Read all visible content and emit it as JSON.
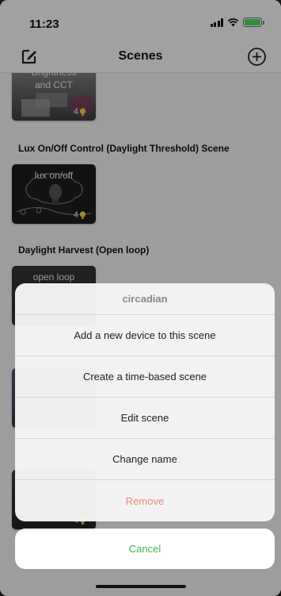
{
  "status_bar": {
    "time": "11:23"
  },
  "nav": {
    "title": "Scenes"
  },
  "scenes": [
    {
      "title": "",
      "card_label": "Brightness and CCT",
      "device_count": "4"
    },
    {
      "title": "Lux On/Off Control (Daylight Threshold) Scene",
      "card_label": "lux on/off",
      "device_count": "4"
    },
    {
      "title": "Daylight Harvest (Open loop)",
      "card_label": "open loop",
      "device_count": ""
    },
    {
      "title": "",
      "card_label": "",
      "device_count": "4"
    }
  ],
  "action_sheet": {
    "header": "circadian",
    "options": [
      {
        "label": "Add a new device to this scene"
      },
      {
        "label": "Create a time-based scene"
      },
      {
        "label": "Edit scene"
      },
      {
        "label": "Change name"
      },
      {
        "label": "Remove"
      }
    ],
    "cancel_label": "Cancel"
  },
  "colors": {
    "accent_green": "#4caf50",
    "destructive": "#e88a7a",
    "bulb_yellow": "#f5d547",
    "battery_green": "#4cd964"
  },
  "icons": [
    "edit-icon",
    "add-circle-icon",
    "bulb-icon",
    "signal-icon",
    "wifi-icon",
    "battery-icon"
  ]
}
